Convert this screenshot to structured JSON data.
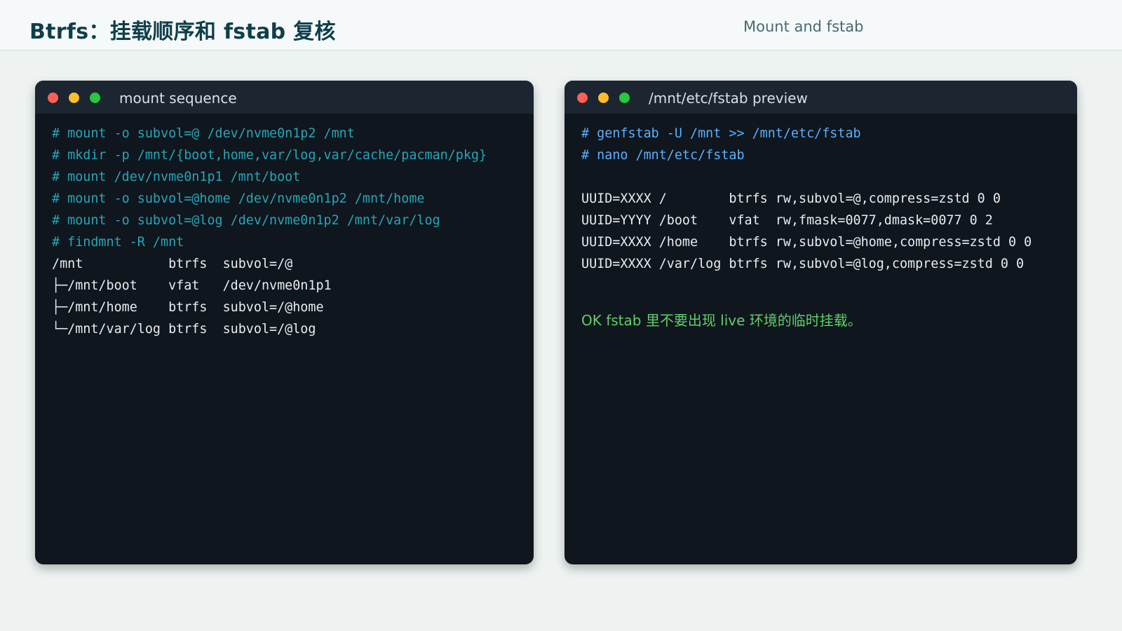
{
  "header": {
    "title": "Btrfs：挂载顺序和 fstab 复核",
    "subtitle": "Mount and fstab"
  },
  "left_terminal": {
    "title": "mount sequence",
    "commands": [
      "# mount -o subvol=@ /dev/nvme0n1p2 /mnt",
      "# mkdir -p /mnt/{boot,home,var/log,var/cache/pacman/pkg}",
      "# mount /dev/nvme0n1p1 /mnt/boot",
      "# mount -o subvol=@home /dev/nvme0n1p2 /mnt/home",
      "# mount -o subvol=@log /dev/nvme0n1p2 /mnt/var/log",
      "# findmnt -R /mnt"
    ],
    "output": [
      "/mnt           btrfs  subvol=/@",
      "├─/mnt/boot    vfat   /dev/nvme0n1p1",
      "├─/mnt/home    btrfs  subvol=/@home",
      "└─/mnt/var/log btrfs  subvol=/@log"
    ]
  },
  "right_terminal": {
    "title": "/mnt/etc/fstab preview",
    "commands": [
      "# genfstab -U /mnt >> /mnt/etc/fstab",
      "# nano /mnt/etc/fstab"
    ],
    "fstab_lines": [
      "UUID=XXXX /        btrfs rw,subvol=@,compress=zstd 0 0",
      "UUID=YYYY /boot    vfat  rw,fmask=0077,dmask=0077 0 2",
      "UUID=XXXX /home    btrfs rw,subvol=@home,compress=zstd 0 0",
      "UUID=XXXX /var/log btrfs rw,subvol=@log,compress=zstd 0 0"
    ],
    "note": "OK fstab 里不要出现 live 环境的临时挂载。"
  },
  "colors": {
    "command_teal": "#25a6b8",
    "command_blue": "#5ab0ff",
    "ok_green": "#5fcf6c",
    "title_dark_teal": "#0f3f4a",
    "terminal_bg": "#0f161d"
  }
}
